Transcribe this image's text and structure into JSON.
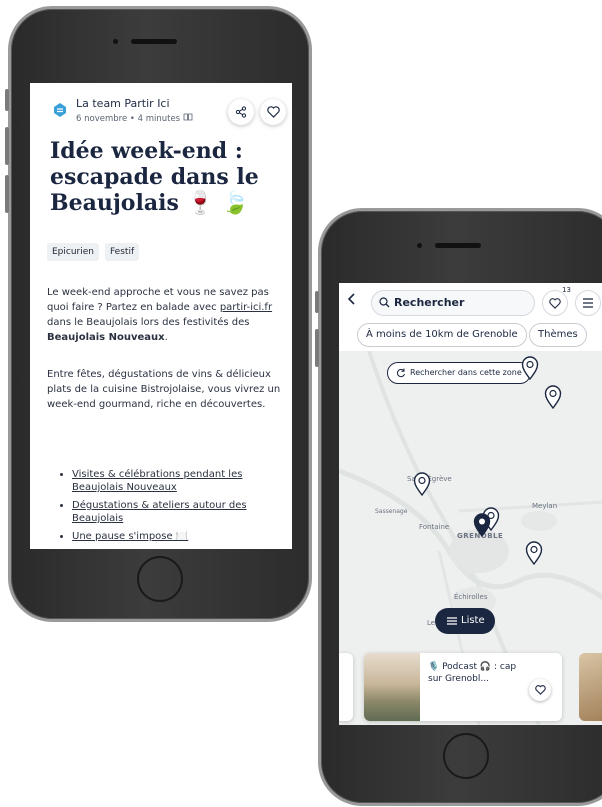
{
  "article": {
    "author_name": "La team Partir Ici",
    "author_meta": "6 novembre • 4 minutes",
    "title": "Idée week-end : escapade dans le Beaujolais 🍷 🍃",
    "tags": [
      "Epicurien",
      "Festif"
    ],
    "para1": {
      "t1": "Le week-end approche et vous ne savez pas quoi faire ? Partez en balade avec ",
      "link": "partir-ici.fr",
      "t2": " dans le Beaujolais lors des festivités des ",
      "bold": "Beaujolais Nouveaux",
      "t3": "."
    },
    "para2": "Entre fêtes, dégustations de vins & délicieux plats de la cuisine Bistrojolaise, vous vivrez un week-end gourmand, riche en découvertes.",
    "bullets": [
      "Visites & célébrations pendant les Beaujolais Nouveaux",
      "Dégustations & ateliers autour des Beaujolais",
      "Une pause s'impose 🍽️"
    ]
  },
  "map_app": {
    "search_placeholder": "Rechercher",
    "favorites_count": "13",
    "filters": [
      "À moins de 10km de Grenoble",
      "Thèmes"
    ],
    "search_zone_label": "Rechercher dans cette zone",
    "map_labels": [
      "Saint-Égrève",
      "Sassenage",
      "Fontaine",
      "GRENOBLE",
      "Meylan",
      "Échirolles",
      "Le"
    ],
    "list_button": "Liste",
    "card_title": "🎙️ Podcast 🎧 : cap sur Grenobl..."
  },
  "colors": {
    "navy": "#1b2740",
    "accent_blue": "#3aa0d8"
  },
  "icons": [
    "share-icon",
    "heart-icon",
    "search-icon",
    "back-chevron-icon",
    "menu-icon",
    "refresh-icon",
    "map-pin-icon",
    "list-icon",
    "book-icon"
  ]
}
